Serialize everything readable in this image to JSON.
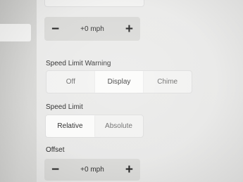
{
  "top_stepper": {
    "decrement_label": "−",
    "value": "+0 mph",
    "increment_label": "+"
  },
  "speed_limit_warning": {
    "label": "Speed Limit Warning",
    "options": [
      "Off",
      "Display",
      "Chime"
    ],
    "selected": "Display"
  },
  "speed_limit": {
    "label": "Speed Limit",
    "options": [
      "Relative",
      "Absolute"
    ],
    "selected": "Relative"
  },
  "offset": {
    "label": "Offset",
    "decrement_label": "−",
    "value": "+0 mph",
    "increment_label": "+"
  }
}
